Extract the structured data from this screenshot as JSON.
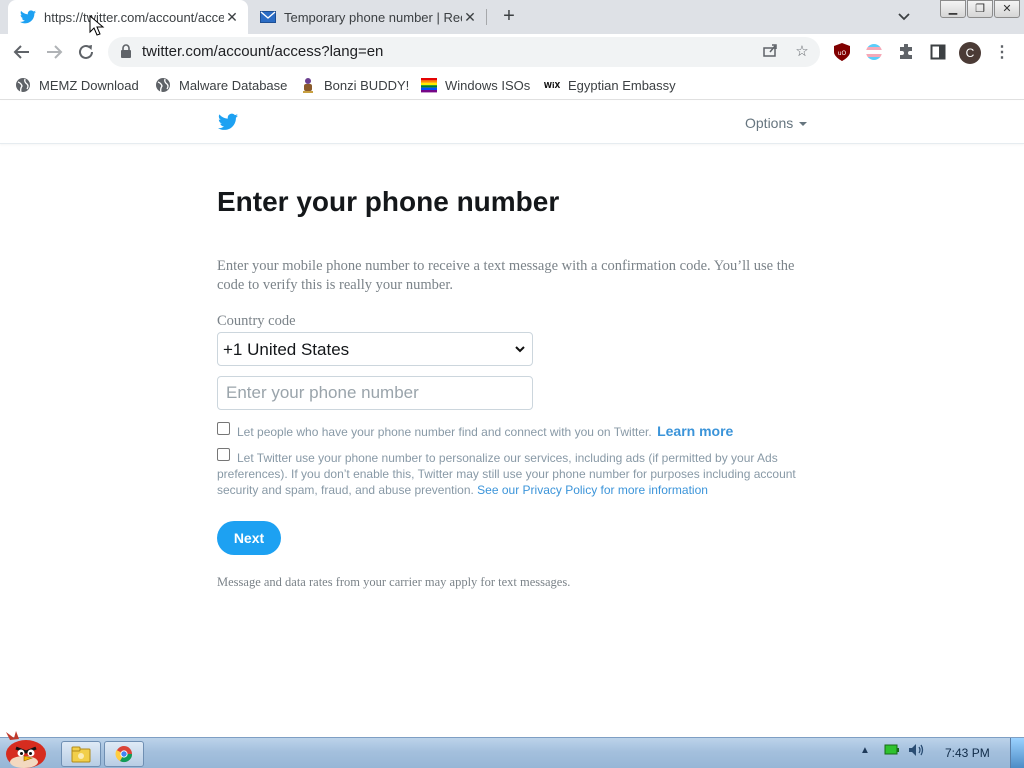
{
  "browser": {
    "tabs": [
      {
        "title": "https://twitter.com/account/access?lang=en",
        "close": "✕"
      },
      {
        "title": "Temporary phone number | Receive SMS",
        "close": "✕"
      }
    ],
    "new_tab": "+",
    "url": "twitter.com/account/access?lang=en",
    "profile_initial": "C",
    "bookmarks": [
      {
        "label": "MEMZ Download",
        "icon": "globe-icon"
      },
      {
        "label": "Malware Database",
        "icon": "globe-icon"
      },
      {
        "label": "Bonzi BUDDY!",
        "icon": "bonzi-icon"
      },
      {
        "label": "Windows ISOs",
        "icon": "rainbow-flag-icon"
      },
      {
        "label": "Egyptian Embassy",
        "icon": "wix-icon"
      }
    ]
  },
  "site": {
    "options_label": "Options",
    "title": "Enter your phone number",
    "intro": "Enter your mobile phone number to receive a text message with a confirmation code. You’ll use the code to verify this is really your number.",
    "country_label": "Country code",
    "country_value": "+1 United States",
    "phone_placeholder": "Enter your phone number",
    "checkbox1_text": "Let people who have your phone number find and connect with you on Twitter.",
    "learn_more": "Learn more",
    "checkbox2_text": "Let Twitter use your phone number to personalize our services, including ads (if permitted by your Ads preferences). If you don’t enable this, Twitter may still use your phone number for purposes including account security and spam, fraud, and abuse prevention.",
    "policy_link": "See our Privacy Policy for more information",
    "next_label": "Next",
    "footer_note": "Message and data rates from your carrier may apply for text messages."
  },
  "taskbar": {
    "clock": "7:43 PM"
  },
  "colors": {
    "twitter_blue": "#1da1f2",
    "link_blue": "#3b94d9",
    "taskbar": "#a4c0dd"
  }
}
